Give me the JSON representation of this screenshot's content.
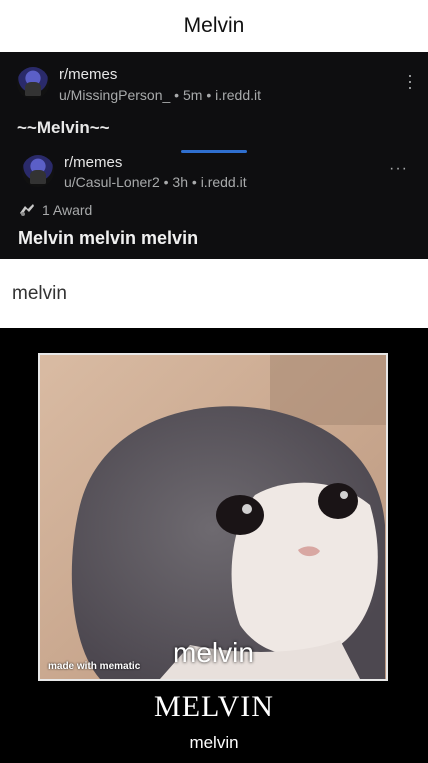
{
  "header": {
    "title": "Melvin"
  },
  "post": {
    "subreddit": "r/memes",
    "user": "u/MissingPerson_",
    "time": "5m",
    "domain": "i.redd.it",
    "separator": "•",
    "title": "~~Melvin~~",
    "menu_icon": "vertical-dots-icon"
  },
  "crosspost": {
    "subreddit": "r/memes",
    "user": "u/Casul-Loner2",
    "time": "3h",
    "domain": "i.redd.it",
    "separator": "•",
    "award_text": "1 Award",
    "title": "Melvin melvin melvin",
    "menu_icon": "horizontal-dots-icon"
  },
  "caption": "melvin",
  "meme": {
    "image_text": "melvin",
    "watermark": "made with mematic",
    "big_title": "MELVIN",
    "small_title": "melvin"
  },
  "colors": {
    "reddit_bg": "#0e0e10",
    "accent_blue": "#2f6fcf",
    "meme_bg": "#000000"
  }
}
